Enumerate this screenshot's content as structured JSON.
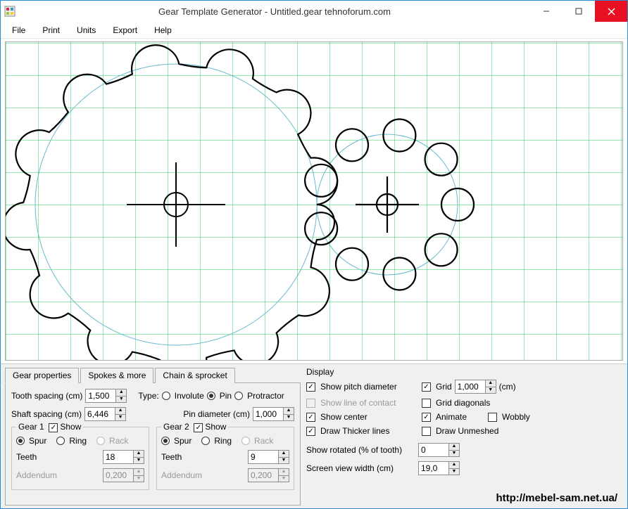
{
  "titlebar": {
    "title": "Gear Template Generator - Untitled.gear     tehnoforum.com"
  },
  "menu": {
    "file": "File",
    "print": "Print",
    "units": "Units",
    "export": "Export",
    "help": "Help"
  },
  "tabs": {
    "gear_properties": "Gear properties",
    "spokes": "Spokes & more",
    "chain": "Chain & sprocket"
  },
  "props": {
    "tooth_spacing_label": "Tooth spacing (cm)",
    "tooth_spacing": "1,500",
    "type_label": "Type:",
    "type_involute": "Involute",
    "type_pin": "Pin",
    "type_protractor": "Protractor",
    "shaft_spacing_label": "Shaft spacing (cm)",
    "shaft_spacing": "6,446",
    "pin_diameter_label": "Pin diameter (cm)",
    "pin_diameter": "1,000",
    "gear1_title": "Gear 1",
    "gear2_title": "Gear 2",
    "show": "Show",
    "spur": "Spur",
    "ring": "Ring",
    "rack": "Rack",
    "teeth": "Teeth",
    "teeth1": "18",
    "teeth2": "9",
    "addendum": "Addendum",
    "addendum_val": "0,200"
  },
  "display": {
    "title": "Display",
    "show_pitch": "Show pitch diameter",
    "grid": "Grid",
    "grid_val": "1,000",
    "cm": "(cm)",
    "show_line": "Show line of contact",
    "grid_diag": "Grid diagonals",
    "show_center": "Show center",
    "animate": "Animate",
    "wobbly": "Wobbly",
    "draw_thicker": "Draw Thicker lines",
    "draw_unmeshed": "Draw Unmeshed",
    "show_rotated": "Show rotated (% of tooth)",
    "rotated_val": "0",
    "screen_width": "Screen view width (cm)",
    "screen_width_val": "19,0"
  },
  "watermark": "http://mebel-sam.net.ua/"
}
